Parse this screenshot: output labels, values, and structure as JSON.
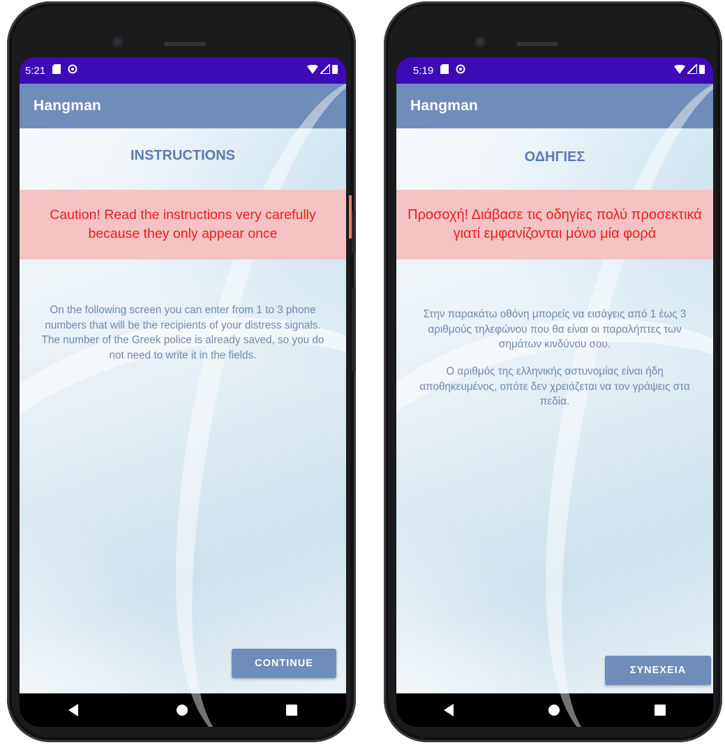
{
  "screens": [
    {
      "status": {
        "time": "5:21"
      },
      "app_title": "Hangman",
      "heading": "INSTRUCTIONS",
      "caution": "Caution! Read the instructions very carefully because they only appear once",
      "body": "On the following screen you can enter from 1 to 3 phone numbers that will be the recipients of your distress signals. The number of the Greek police is already saved, so you do not need to write it in the fields.",
      "button": "CONTINUE"
    },
    {
      "status": {
        "time": "5:19"
      },
      "app_title": "Hangman",
      "heading": "ΟΔΗΓΙΕΣ",
      "caution": "Προσοχή! Διάβασε τις οδηγίες πολύ προσεκτικά γιατί εμφανίζονται μόνο μία φορά",
      "body": "Στην παρακάτω οθόνη μπορείς να εισάγεις από 1 έως 3 αριθμούς τηλεφώνου που θα είναι οι παραλήπτες των σημάτων κινδύνου σου.",
      "body2": "Ο αριθμός της ελληνικής αστυνομίας είναι ήδη αποθηκευμένος, οπότε δεν χρειάζεται να τον γράψεις στα πεδία.",
      "button": "ΣΥΝΕΧΕΙΑ"
    }
  ],
  "colors": {
    "status_bar": "#3d0bb5",
    "app_bar": "#6e8db9",
    "caution_bg": "#f5c3c4",
    "caution_text": "#ee1c1c",
    "heading": "#5b7db0"
  },
  "icons": [
    "sd-card-icon",
    "sync-icon",
    "wifi-icon",
    "signal-icon",
    "battery-icon",
    "back-icon",
    "home-icon",
    "recents-icon"
  ]
}
